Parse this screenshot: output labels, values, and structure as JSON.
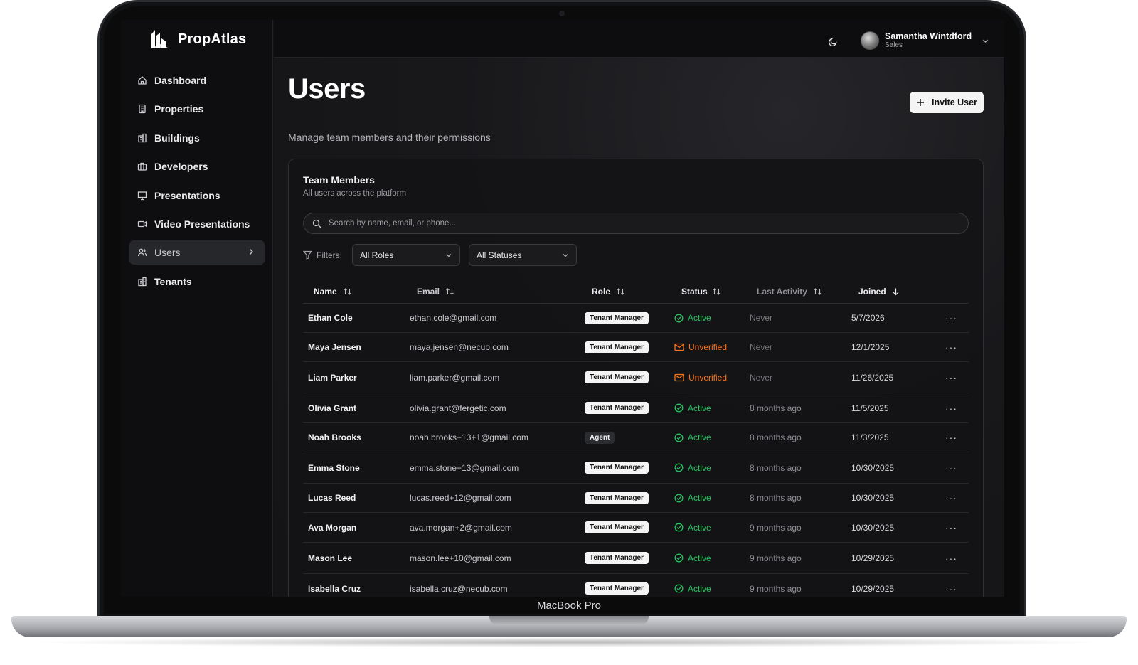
{
  "device": {
    "label": "MacBook Pro"
  },
  "app": {
    "name": "PropAtlas"
  },
  "user": {
    "name": "Samantha Wintdford",
    "role": "Sales"
  },
  "sidebar": {
    "items": [
      {
        "label": "Dashboard",
        "icon": "home-icon"
      },
      {
        "label": "Properties",
        "icon": "building-icon"
      },
      {
        "label": "Buildings",
        "icon": "buildings-icon"
      },
      {
        "label": "Developers",
        "icon": "briefcase-icon"
      },
      {
        "label": "Presentations",
        "icon": "presentation-icon"
      },
      {
        "label": "Video Presentations",
        "icon": "video-icon"
      },
      {
        "label": "Users",
        "icon": "users-icon",
        "active": true
      },
      {
        "label": "Tenants",
        "icon": "tenants-icon"
      }
    ]
  },
  "page": {
    "title": "Users",
    "subtitle": "Manage team members and their permissions",
    "invite_label": "Invite User"
  },
  "card": {
    "title": "Team Members",
    "subtitle": "All users across the platform",
    "search_placeholder": "Search by name, email, or phone...",
    "filters_label": "Filters:",
    "role_filter": "All Roles",
    "status_filter": "All Statuses"
  },
  "table": {
    "columns": [
      "Name",
      "Email",
      "Role",
      "Status",
      "Last Activity",
      "Joined"
    ],
    "rows": [
      {
        "name": "Ethan Cole",
        "email": "ethan.cole@gmail.com",
        "role": "Tenant Manager",
        "status": "Active",
        "activity": "Never",
        "joined": "5/7/2026"
      },
      {
        "name": "Maya Jensen",
        "email": "maya.jensen@necub.com",
        "role": "Tenant Manager",
        "status": "Unverified",
        "activity": "Never",
        "joined": "12/1/2025"
      },
      {
        "name": "Liam Parker",
        "email": "liam.parker@gmail.com",
        "role": "Tenant Manager",
        "status": "Unverified",
        "activity": "Never",
        "joined": "11/26/2025"
      },
      {
        "name": "Olivia Grant",
        "email": "olivia.grant@fergetic.com",
        "role": "Tenant Manager",
        "status": "Active",
        "activity": "8 months ago",
        "joined": "11/5/2025"
      },
      {
        "name": "Noah Brooks",
        "email": "noah.brooks+13+1@gmail.com",
        "role": "Agent",
        "status": "Active",
        "activity": "8 months ago",
        "joined": "11/3/2025"
      },
      {
        "name": "Emma Stone",
        "email": "emma.stone+13@gmail.com",
        "role": "Tenant Manager",
        "status": "Active",
        "activity": "8 months ago",
        "joined": "10/30/2025"
      },
      {
        "name": "Lucas Reed",
        "email": "lucas.reed+12@gmail.com",
        "role": "Tenant Manager",
        "status": "Active",
        "activity": "8 months ago",
        "joined": "10/30/2025"
      },
      {
        "name": "Ava Morgan",
        "email": "ava.morgan+2@gmail.com",
        "role": "Tenant Manager",
        "status": "Active",
        "activity": "9 months ago",
        "joined": "10/30/2025"
      },
      {
        "name": "Mason Lee",
        "email": "mason.lee+10@gmail.com",
        "role": "Tenant Manager",
        "status": "Active",
        "activity": "9 months ago",
        "joined": "10/29/2025"
      },
      {
        "name": "Isabella Cruz",
        "email": "isabella.cruz@necub.com",
        "role": "Tenant Manager",
        "status": "Active",
        "activity": "9 months ago",
        "joined": "10/29/2025"
      }
    ]
  },
  "colors": {
    "active": "#22c55e",
    "unverified": "#f97316",
    "background": "#121214"
  }
}
